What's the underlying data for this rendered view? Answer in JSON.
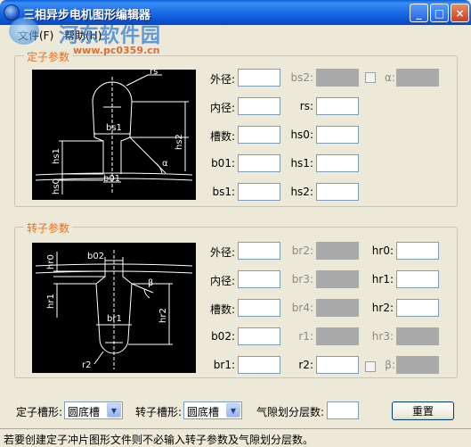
{
  "window": {
    "title": "三相异步电机图形编辑器"
  },
  "titlebar_buttons": {
    "minimize": "_",
    "maximize": "□",
    "close": "×"
  },
  "watermark": {
    "name": "河东软件园",
    "url": "www.pc0359.cn"
  },
  "menu": {
    "file": "文件(F)",
    "help": "帮助(H)"
  },
  "stator": {
    "group_title": "定子参数",
    "diagram_labels": {
      "rs": "rs",
      "bs1": "bs1",
      "hs2": "hs2",
      "hs1": "hs1",
      "hs0": "hs0",
      "b01": "b01",
      "alpha": "α"
    },
    "fields": {
      "outer_dia": {
        "label": "外径:",
        "value": ""
      },
      "inner_dia": {
        "label": "内径:",
        "value": ""
      },
      "slots": {
        "label": "槽数:",
        "value": ""
      },
      "b01": {
        "label": "b01:",
        "value": ""
      },
      "bs1": {
        "label": "bs1:",
        "value": ""
      },
      "bs2": {
        "label": "bs2:",
        "value": ""
      },
      "rs": {
        "label": "rs:",
        "value": ""
      },
      "hs0": {
        "label": "hs0:",
        "value": ""
      },
      "hs1": {
        "label": "hs1:",
        "value": ""
      },
      "hs2": {
        "label": "hs2:",
        "value": ""
      },
      "alpha": {
        "label": "α:",
        "value": ""
      }
    }
  },
  "rotor": {
    "group_title": "转子参数",
    "diagram_labels": {
      "hr0": "hr0",
      "b02": "b02",
      "beta": "β",
      "hr1": "hr1",
      "br1": "br1",
      "hr2": "hr2",
      "r2": "r2"
    },
    "fields": {
      "outer_dia": {
        "label": "外径:",
        "value": ""
      },
      "inner_dia": {
        "label": "内径:",
        "value": ""
      },
      "slots": {
        "label": "槽数:",
        "value": ""
      },
      "b02": {
        "label": "b02:",
        "value": ""
      },
      "br1": {
        "label": "br1:",
        "value": ""
      },
      "br2": {
        "label": "br2:",
        "value": ""
      },
      "br3": {
        "label": "br3:",
        "value": ""
      },
      "br4": {
        "label": "br4:",
        "value": ""
      },
      "r1": {
        "label": "r1:",
        "value": ""
      },
      "r2": {
        "label": "r2:",
        "value": ""
      },
      "hr0": {
        "label": "hr0:",
        "value": ""
      },
      "hr1": {
        "label": "hr1:",
        "value": ""
      },
      "hr2": {
        "label": "hr2:",
        "value": ""
      },
      "hr3": {
        "label": "hr3:",
        "value": ""
      },
      "beta": {
        "label": "β:",
        "value": ""
      }
    }
  },
  "bottom": {
    "stator_slot_label": "定子槽形:",
    "stator_slot_value": "圆底槽",
    "rotor_slot_label": "转子槽形:",
    "rotor_slot_value": "圆底槽",
    "airgap_label": "气隙划分层数:",
    "airgap_value": "",
    "reset_button": "重置"
  },
  "status": {
    "text": "若要创建定子冲片图形文件则不必输入转子参数及气隙划分层数。"
  }
}
